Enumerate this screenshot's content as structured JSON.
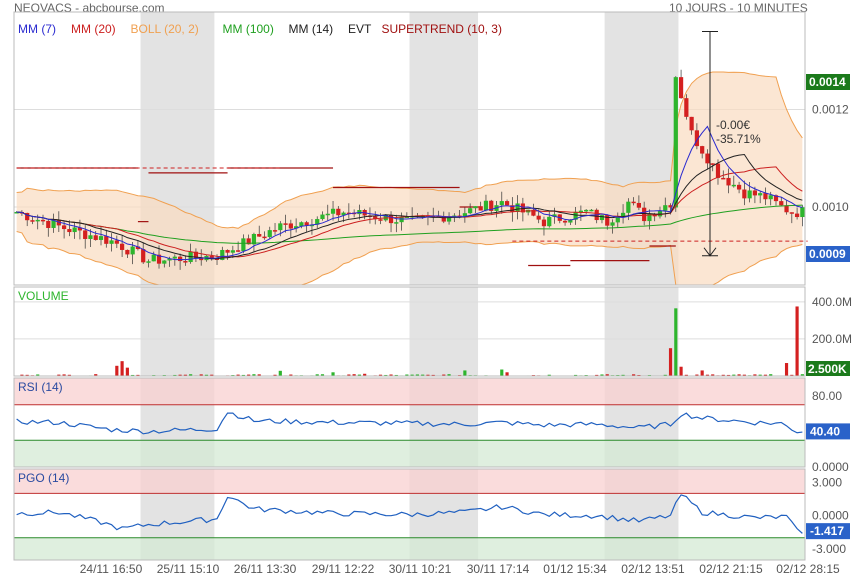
{
  "header": {
    "title": "NEOVACS - abcbourse.com",
    "period": "10 JOURS - 10 MINUTES"
  },
  "colors": {
    "up": "#2db52d",
    "down": "#d42020",
    "boll": "#f0a050",
    "boll_fill": "#f9dcc0",
    "mm7": "#2a2ad0",
    "mm20": "#cc2020",
    "mm100": "#20a020",
    "mm14": "#222222",
    "supertrend": "#a01010",
    "rsi": "#2060c0",
    "pgo": "#2060c0",
    "night_shade": "#e3e3e3",
    "overbought": "#f8d0d0",
    "oversold": "#d4ead4"
  },
  "chart_data": [
    {
      "type": "candlestick",
      "indicators": [
        {
          "label": "MM (7)",
          "color": "#2a2ad0"
        },
        {
          "label": "MM (20)",
          "color": "#cc2020"
        },
        {
          "label": "BOLL (20, 2)",
          "color": "#f0a050"
        },
        {
          "label": "MM (100)",
          "color": "#20a020"
        },
        {
          "label": "MM (14)",
          "color": "#222222"
        },
        {
          "label": "EVT",
          "color": "#222222"
        },
        {
          "label": "SUPERTREND (10, 3)",
          "color": "#a01010"
        }
      ],
      "y_ticks": [
        {
          "value": 0.001,
          "label": "0.0010"
        },
        {
          "value": 0.0012,
          "label": "0.0012"
        }
      ],
      "ylim": [
        0.00084,
        0.0014
      ],
      "last_price": "0.0009",
      "high_marker": "0.0014",
      "evt_change": "-0.00€",
      "evt_pct": "-35.71%",
      "anchors": [
        [
          0,
          0.00099
        ],
        [
          8,
          0.00096
        ],
        [
          18,
          0.00093
        ],
        [
          20,
          0.00092
        ],
        [
          25,
          0.00089
        ],
        [
          38,
          0.0009
        ],
        [
          50,
          0.00096
        ],
        [
          62,
          0.00099
        ],
        [
          75,
          0.00097
        ],
        [
          85,
          0.00099
        ],
        [
          92,
          0.00101
        ],
        [
          100,
          0.00097
        ],
        [
          108,
          0.00099
        ],
        [
          112,
          0.00097
        ],
        [
          116,
          0.00101
        ],
        [
          119,
          0.00098
        ],
        [
          124,
          0.00101
        ],
        [
          125,
          0.00127
        ],
        [
          128,
          0.00115
        ],
        [
          133,
          0.00107
        ],
        [
          138,
          0.00103
        ],
        [
          142,
          0.00102
        ],
        [
          145,
          0.001
        ],
        [
          147,
          0.00099
        ]
      ],
      "supertrend": [
        {
          "from": 0,
          "to": 23,
          "value": 0.00108
        },
        {
          "from": 23,
          "to": 25,
          "value": 0.00097
        },
        {
          "from": 25,
          "to": 40,
          "value": 0.00107
        },
        {
          "from": 40,
          "to": 60,
          "value": 0.00108
        },
        {
          "from": 60,
          "to": 84,
          "value": 0.00104
        },
        {
          "from": 84,
          "to": 88,
          "value": 0.001
        },
        {
          "from": 97,
          "to": 105,
          "value": 0.00088
        },
        {
          "from": 105,
          "to": 120,
          "value": 0.00089
        },
        {
          "from": 120,
          "to": 125,
          "value": 0.00092
        }
      ],
      "dashed_levels": [
        {
          "from": 0,
          "to": 50,
          "value": 0.00108,
          "color": "#cc2020"
        },
        {
          "from": 94,
          "to": 150,
          "value": 0.00093,
          "color": "#cc2020"
        }
      ]
    },
    {
      "type": "bar",
      "title": "VOLUME",
      "y_ticks": [
        {
          "value": 200,
          "label": "200.0M"
        },
        {
          "value": 400,
          "label": "400.0M"
        }
      ],
      "ylim": [
        0,
        480
      ],
      "last_value": "2.500K",
      "spikes": [
        {
          "i": 19,
          "v": 55
        },
        {
          "i": 20,
          "v": 80
        },
        {
          "i": 21,
          "v": 45
        },
        {
          "i": 50,
          "v": 28
        },
        {
          "i": 60,
          "v": 20
        },
        {
          "i": 66,
          "v": 12
        },
        {
          "i": 85,
          "v": 30
        },
        {
          "i": 92,
          "v": 35
        },
        {
          "i": 93,
          "v": 20
        },
        {
          "i": 124,
          "v": 150
        },
        {
          "i": 125,
          "v": 365
        },
        {
          "i": 126,
          "v": 50
        },
        {
          "i": 130,
          "v": 30
        },
        {
          "i": 146,
          "v": 70
        },
        {
          "i": 148,
          "v": 375
        }
      ]
    },
    {
      "type": "line",
      "title": "RSI (14)",
      "y_ticks": [
        {
          "value": 0,
          "label": "0.0000"
        },
        {
          "value": 80,
          "label": "80.00"
        }
      ],
      "ylim": [
        0,
        100
      ],
      "last_value": "40.40",
      "overbought_from": 70,
      "oversold_to": 30,
      "anchors": [
        [
          0,
          51
        ],
        [
          8,
          50
        ],
        [
          18,
          42
        ],
        [
          25,
          40
        ],
        [
          38,
          43
        ],
        [
          40,
          62
        ],
        [
          45,
          52
        ],
        [
          60,
          50
        ],
        [
          75,
          49
        ],
        [
          85,
          48
        ],
        [
          92,
          50
        ],
        [
          100,
          47
        ],
        [
          110,
          48
        ],
        [
          118,
          44
        ],
        [
          124,
          48
        ],
        [
          126,
          60
        ],
        [
          130,
          55
        ],
        [
          140,
          50
        ],
        [
          145,
          49
        ],
        [
          148,
          40
        ]
      ]
    },
    {
      "type": "line",
      "title": "PGO (14)",
      "y_ticks": [
        {
          "value": 3,
          "label": "3.000"
        },
        {
          "value": 0,
          "label": "0.0000"
        },
        {
          "value": -3,
          "label": "-3.000"
        }
      ],
      "ylim": [
        -4,
        4.2
      ],
      "last_value": "-1.417",
      "overbought_from": 2,
      "oversold_to": -2,
      "anchors": [
        [
          0,
          0.2
        ],
        [
          8,
          0.3
        ],
        [
          16,
          -0.6
        ],
        [
          20,
          -1.2
        ],
        [
          25,
          -0.8
        ],
        [
          38,
          -0.3
        ],
        [
          40,
          1.8
        ],
        [
          45,
          0.6
        ],
        [
          60,
          0.2
        ],
        [
          75,
          0.1
        ],
        [
          85,
          0.3
        ],
        [
          92,
          0.8
        ],
        [
          100,
          0.1
        ],
        [
          110,
          0.0
        ],
        [
          118,
          -0.5
        ],
        [
          124,
          0.0
        ],
        [
          126,
          1.9
        ],
        [
          130,
          0.3
        ],
        [
          140,
          -0.2
        ],
        [
          146,
          -0.1
        ],
        [
          148,
          -1.4
        ]
      ]
    }
  ],
  "x_axis": {
    "labels": [
      "24/11 16:50",
      "25/11 15:10",
      "26/11 13:30",
      "29/11 12:22",
      "30/11 10:21",
      "30/11 17:14",
      "01/12 15:34",
      "02/12 13:51",
      "02/12 21:15",
      "02/12 28:15"
    ]
  }
}
